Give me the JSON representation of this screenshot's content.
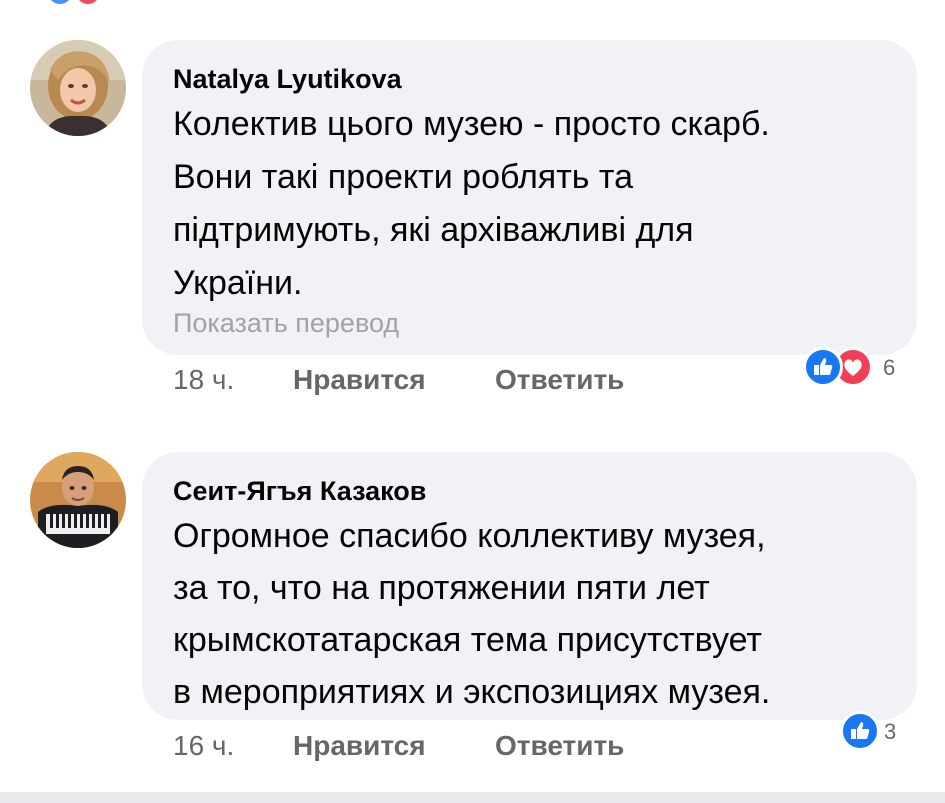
{
  "comments": [
    {
      "author": "Natalya  Lyutikova",
      "text_lines": [
        "Колектив цього музею - просто скарб.",
        "Вони такі проекти роблять та",
        "підтримують, які архіважливі для",
        "України."
      ],
      "translate_label": "Показать перевод",
      "time": "18 ч.",
      "like_label": "Нравится",
      "reply_label": "Ответить",
      "reaction_icons": [
        "like-icon",
        "love-icon"
      ],
      "reaction_count": "6"
    },
    {
      "author": "Сеит-Ягъя Казаков",
      "text_lines": [
        "Огромное спасибо коллективу музея,",
        "за то, что на протяжении пяти лет",
        "крымскотатарская тема присутствует",
        "в мероприятиях и экспозициях музея."
      ],
      "time": "16 ч.",
      "like_label": "Нравится",
      "reply_label": "Ответить",
      "reaction_icons": [
        "like-icon"
      ],
      "reaction_count": "3"
    }
  ],
  "colors": {
    "bubble": "#f0f2f5",
    "meta_text": "#65676b",
    "translate_text": "#a0a3a8",
    "like_blue": "#1877f2",
    "love_red": "#f33e58"
  }
}
